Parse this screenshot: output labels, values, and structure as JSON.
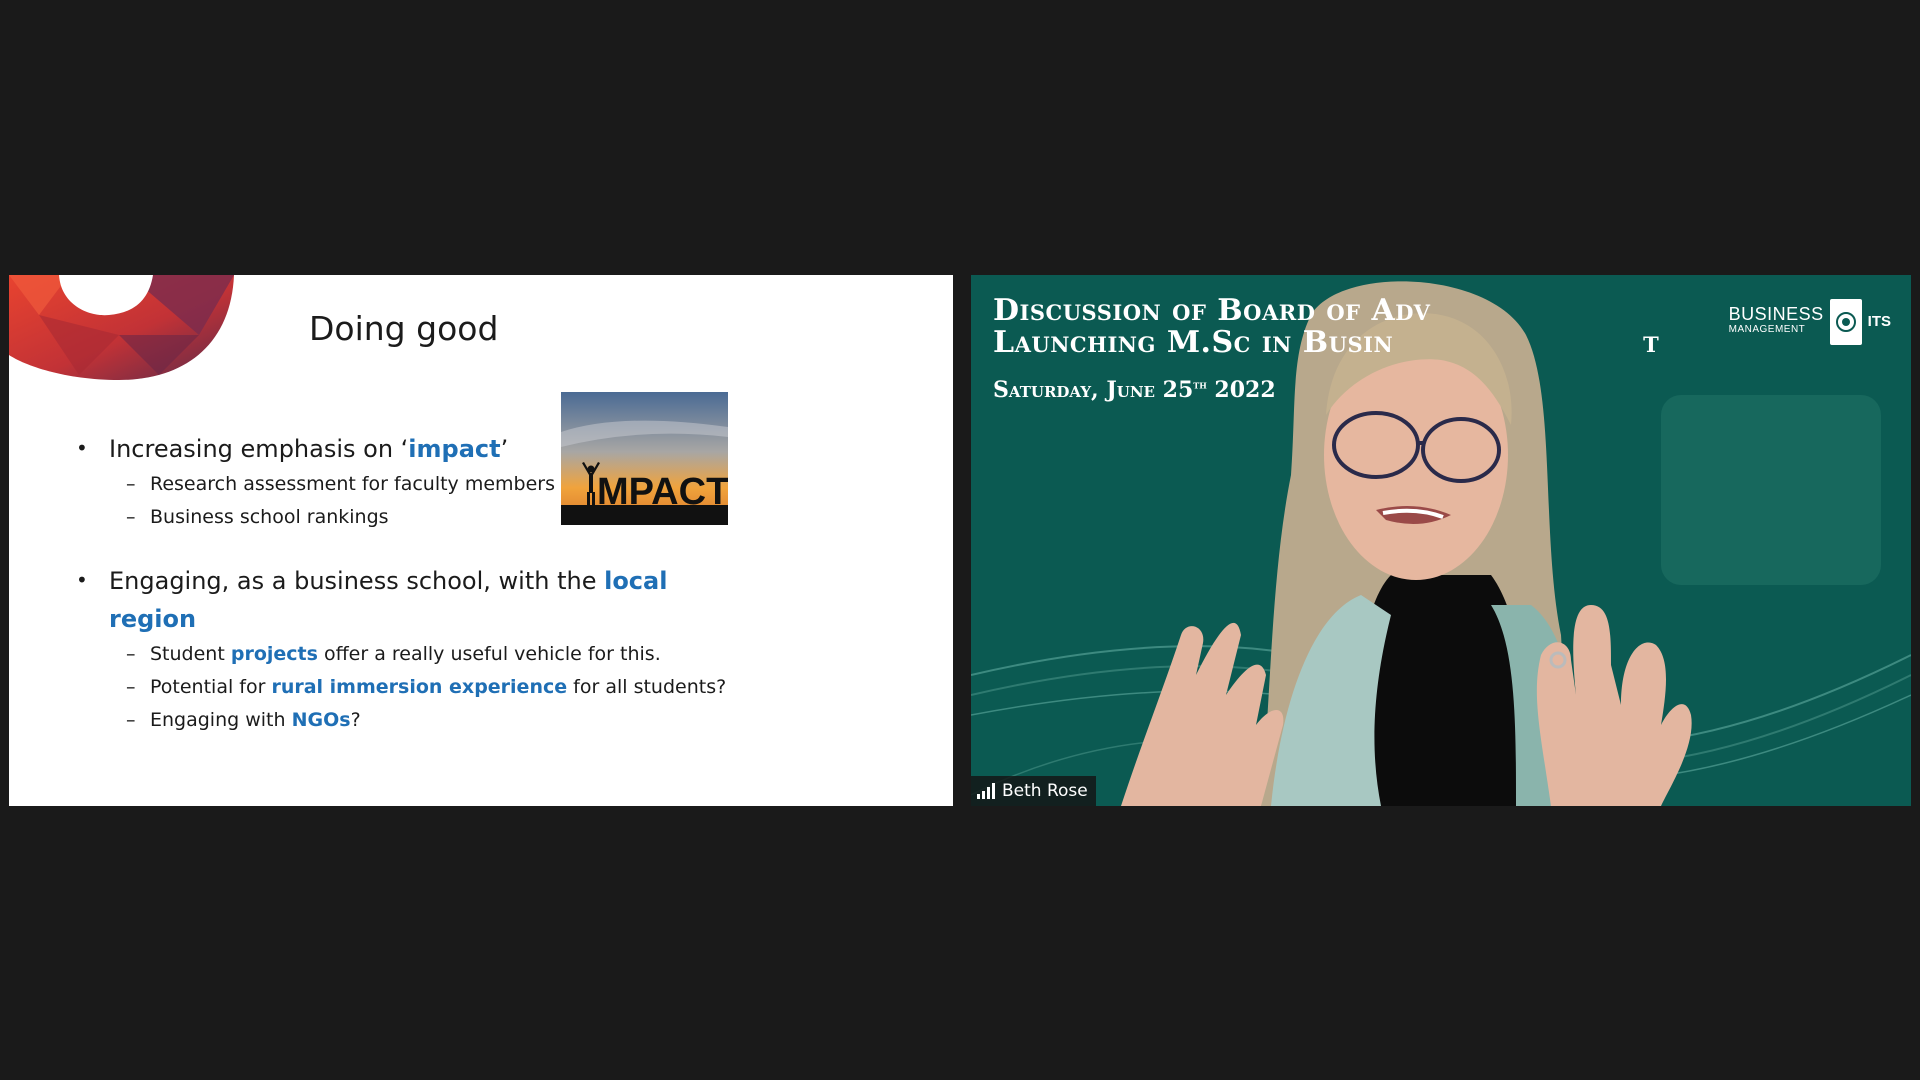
{
  "slide": {
    "title": "Doing good",
    "bullets": [
      {
        "prefix": "Increasing emphasis on ‘",
        "highlight": "impact",
        "suffix": "’",
        "subs": [
          {
            "text": "Research assessment for faculty members"
          },
          {
            "text": "Business school rankings"
          }
        ]
      },
      {
        "prefix": "Engaging, as a business school, with the ",
        "highlight": "local region",
        "suffix": "",
        "subs": [
          {
            "prefix": "Student ",
            "highlight": "projects",
            "suffix": " offer a really useful vehicle for this."
          },
          {
            "prefix": "Potential for ",
            "highlight": "rural immersion experience",
            "suffix": " for all students?"
          },
          {
            "prefix": "Engaging with ",
            "highlight": "NGOs",
            "suffix": "?"
          }
        ]
      }
    ],
    "image_word": "MPACT",
    "highlight_color": "#1f6fb5"
  },
  "video": {
    "banner_line1": "Discussion of Board of Adv",
    "banner_line2": "Launching M.Sc in Busin",
    "banner_line2_tail": "t",
    "banner_date_prefix": "Saturday, June 25",
    "banner_date_sup": "th",
    "banner_date_year": " 2022",
    "brand_big": "BUSINESS",
    "brand_small": "MANAGEMENT",
    "brand_its": "ITS",
    "participant_name": "Beth Rose",
    "tile_color": "#0b5a52"
  }
}
